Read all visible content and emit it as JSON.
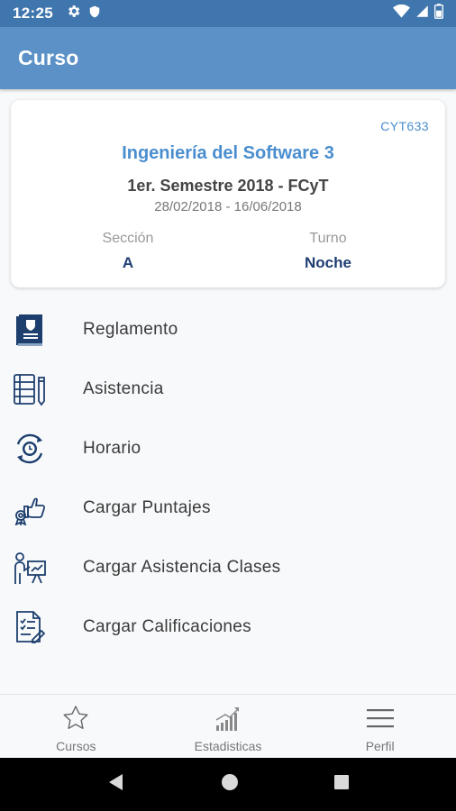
{
  "status_bar": {
    "time": "12:25",
    "icons_left": [
      "gear-icon",
      "shield-icon"
    ],
    "icons_right": [
      "wifi-icon",
      "signal-icon",
      "battery-icon"
    ]
  },
  "app_bar": {
    "title": "Curso"
  },
  "course": {
    "code": "CYT633",
    "name": "Ingeniería del Software 3",
    "semester": "1er. Semestre 2018 - FCyT",
    "dates": "28/02/2018 - 16/06/2018",
    "section_label": "Sección",
    "section_value": "A",
    "shift_label": "Turno",
    "shift_value": "Noche"
  },
  "menu": {
    "items": [
      {
        "label": "Reglamento",
        "icon": "rulebook-icon"
      },
      {
        "label": "Asistencia",
        "icon": "attendance-icon"
      },
      {
        "label": "Horario",
        "icon": "clock-24h-icon"
      },
      {
        "label": "Cargar Puntajes",
        "icon": "thumbs-up-award-icon"
      },
      {
        "label": "Cargar Asistencia Clases",
        "icon": "teacher-presentation-icon"
      },
      {
        "label": "Cargar Calificaciones",
        "icon": "grades-document-icon"
      }
    ]
  },
  "bottom_nav": {
    "items": [
      {
        "label": "Cursos",
        "icon": "star-icon"
      },
      {
        "label": "Estadisticas",
        "icon": "bar-chart-icon"
      },
      {
        "label": "Perfil",
        "icon": "menu-icon"
      }
    ]
  },
  "system_nav": {
    "icons": [
      "back-icon",
      "home-icon",
      "recents-icon"
    ]
  },
  "colors": {
    "status_bar": "#3f76ad",
    "app_bar": "#5b91c6",
    "accent_blue": "#4a8ecf",
    "dark_navy": "#1f3d73",
    "icon_navy": "#1d3f6e"
  }
}
